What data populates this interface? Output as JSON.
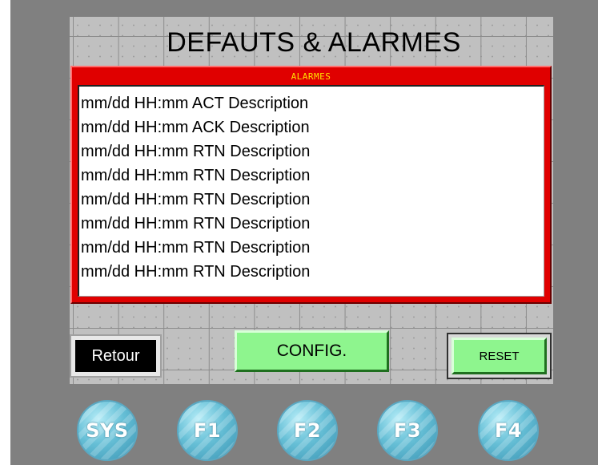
{
  "screen": {
    "title": "DEFAUTS & ALARMES"
  },
  "alarm_panel": {
    "header": "ALARMES",
    "rows": [
      "mm/dd HH:mm ACT Description",
      "mm/dd HH:mm ACK Description",
      "mm/dd HH:mm RTN Description",
      "mm/dd HH:mm RTN Description",
      "mm/dd HH:mm RTN Description",
      "mm/dd HH:mm RTN Description",
      "mm/dd HH:mm RTN Description",
      "mm/dd HH:mm RTN Description"
    ]
  },
  "buttons": {
    "retour": "Retour",
    "config": "CONFIG.",
    "reset": "RESET"
  },
  "function_keys": [
    "SYS",
    "F1",
    "F2",
    "F3",
    "F4"
  ],
  "colors": {
    "alarm_frame": "#e00000",
    "alarm_header_text": "#ffe000",
    "button_green": "#8ef58e",
    "function_key": "#66bfd6"
  }
}
